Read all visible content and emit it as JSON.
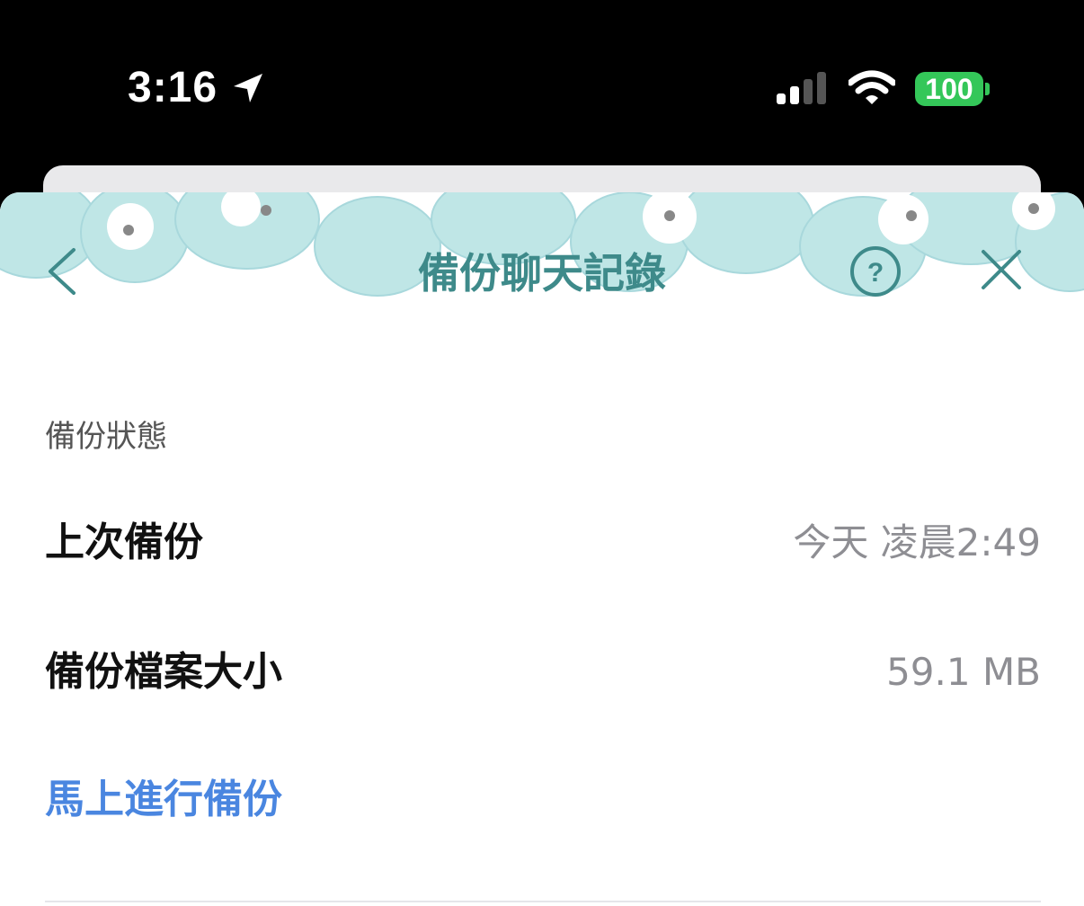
{
  "status_bar": {
    "time": "3:16",
    "battery": "100",
    "battery_color": "#34c759"
  },
  "header": {
    "title": "備份聊天記錄",
    "back_icon": "chevron-left-icon",
    "help_icon": "question-circle-icon",
    "close_icon": "close-icon",
    "accent_color": "#3e8a8a"
  },
  "section": {
    "title": "備份狀態"
  },
  "rows": [
    {
      "label": "上次備份",
      "value": "今天 凌晨2:49"
    },
    {
      "label": "備份檔案大小",
      "value": "59.1 MB"
    }
  ],
  "actions": {
    "backup_now": "馬上進行備份",
    "link_color": "#4a86e0"
  }
}
